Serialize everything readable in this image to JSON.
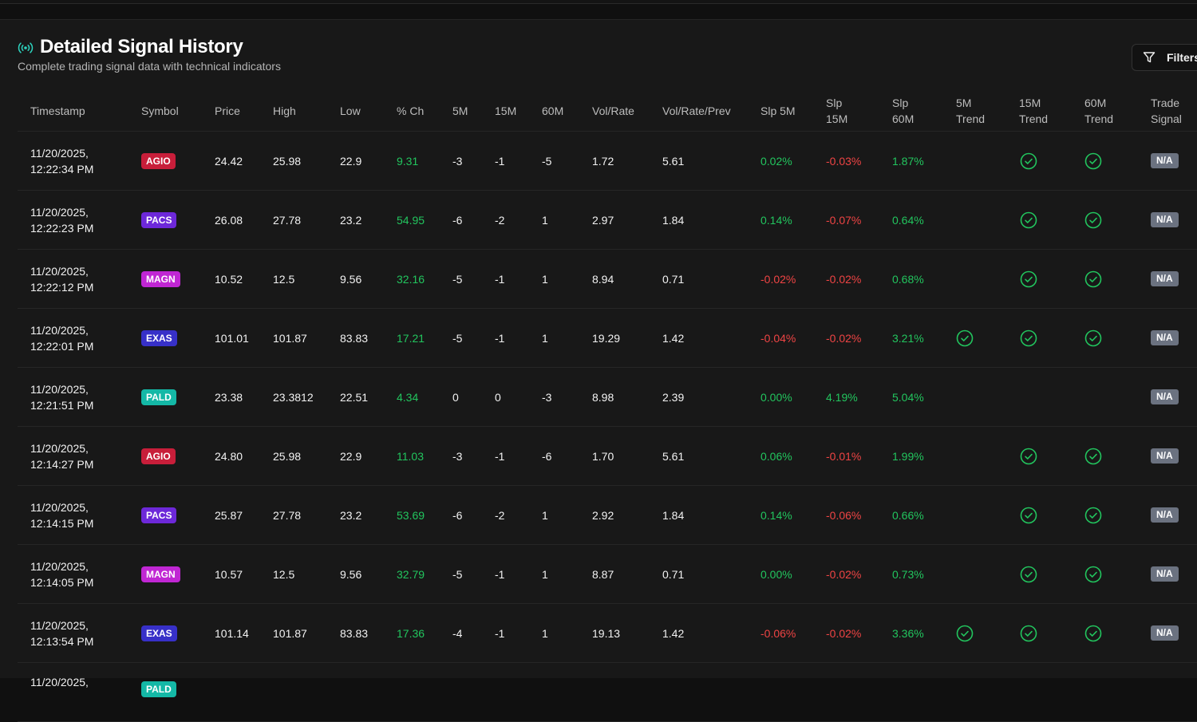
{
  "title": "Detailed Signal History",
  "subtitle": "Complete trading signal data with technical indicators",
  "filters_label": "Filters",
  "colors": {
    "AGIO": "#c81e3a",
    "PACS": "#6d28d9",
    "MAGN": "#c026d3",
    "EXAS": "#3730c8",
    "PALD": "#14b8a6",
    "positive": "#22c55e",
    "negative": "#ef4444"
  },
  "headers": {
    "timestamp": "Timestamp",
    "symbol": "Symbol",
    "price": "Price",
    "high": "High",
    "low": "Low",
    "pct_ch": "% Ch",
    "m5": "5M",
    "m15": "15M",
    "m60": "60M",
    "vol_rate": "Vol/Rate",
    "vol_rate_prev": "Vol/Rate/Prev",
    "slp5": "Slp 5M",
    "slp15_a": "Slp",
    "slp15_b": "15M",
    "slp60_a": "Slp",
    "slp60_b": "60M",
    "t5_a": "5M",
    "t5_b": "Trend",
    "t15_a": "15M",
    "t15_b": "Trend",
    "t60_a": "60M",
    "t60_b": "Trend",
    "sig_a": "Trade",
    "sig_b": "Signal"
  },
  "rows": [
    {
      "date": "11/20/2025,",
      "time": "12:22:34 PM",
      "symbol": "AGIO",
      "price": "24.42",
      "high": "25.98",
      "low": "22.9",
      "pct": "9.31",
      "m5": "-3",
      "m15": "-1",
      "m60": "-5",
      "vol": "1.72",
      "volprev": "5.61",
      "slp5": "0.02%",
      "slp5_pos": true,
      "slp15": "-0.03%",
      "slp15_pos": false,
      "slp60": "1.87%",
      "slp60_pos": true,
      "t5": false,
      "t15": true,
      "t60": true,
      "signal": "N/A"
    },
    {
      "date": "11/20/2025,",
      "time": "12:22:23 PM",
      "symbol": "PACS",
      "price": "26.08",
      "high": "27.78",
      "low": "23.2",
      "pct": "54.95",
      "m5": "-6",
      "m15": "-2",
      "m60": "1",
      "vol": "2.97",
      "volprev": "1.84",
      "slp5": "0.14%",
      "slp5_pos": true,
      "slp15": "-0.07%",
      "slp15_pos": false,
      "slp60": "0.64%",
      "slp60_pos": true,
      "t5": false,
      "t15": true,
      "t60": true,
      "signal": "N/A"
    },
    {
      "date": "11/20/2025,",
      "time": "12:22:12 PM",
      "symbol": "MAGN",
      "price": "10.52",
      "high": "12.5",
      "low": "9.56",
      "pct": "32.16",
      "m5": "-5",
      "m15": "-1",
      "m60": "1",
      "vol": "8.94",
      "volprev": "0.71",
      "slp5": "-0.02%",
      "slp5_pos": false,
      "slp15": "-0.02%",
      "slp15_pos": false,
      "slp60": "0.68%",
      "slp60_pos": true,
      "t5": false,
      "t15": true,
      "t60": true,
      "signal": "N/A"
    },
    {
      "date": "11/20/2025,",
      "time": "12:22:01 PM",
      "symbol": "EXAS",
      "price": "101.01",
      "high": "101.87",
      "low": "83.83",
      "pct": "17.21",
      "m5": "-5",
      "m15": "-1",
      "m60": "1",
      "vol": "19.29",
      "volprev": "1.42",
      "slp5": "-0.04%",
      "slp5_pos": false,
      "slp15": "-0.02%",
      "slp15_pos": false,
      "slp60": "3.21%",
      "slp60_pos": true,
      "t5": true,
      "t15": true,
      "t60": true,
      "signal": "N/A"
    },
    {
      "date": "11/20/2025,",
      "time": "12:21:51 PM",
      "symbol": "PALD",
      "price": "23.38",
      "high": "23.3812",
      "low": "22.51",
      "pct": "4.34",
      "m5": "0",
      "m15": "0",
      "m60": "-3",
      "vol": "8.98",
      "volprev": "2.39",
      "slp5": "0.00%",
      "slp5_pos": true,
      "slp15": "4.19%",
      "slp15_pos": true,
      "slp60": "5.04%",
      "slp60_pos": true,
      "t5": false,
      "t15": false,
      "t60": false,
      "signal": "N/A"
    },
    {
      "date": "11/20/2025,",
      "time": "12:14:27 PM",
      "symbol": "AGIO",
      "price": "24.80",
      "high": "25.98",
      "low": "22.9",
      "pct": "11.03",
      "m5": "-3",
      "m15": "-1",
      "m60": "-6",
      "vol": "1.70",
      "volprev": "5.61",
      "slp5": "0.06%",
      "slp5_pos": true,
      "slp15": "-0.01%",
      "slp15_pos": false,
      "slp60": "1.99%",
      "slp60_pos": true,
      "t5": false,
      "t15": true,
      "t60": true,
      "signal": "N/A"
    },
    {
      "date": "11/20/2025,",
      "time": "12:14:15 PM",
      "symbol": "PACS",
      "price": "25.87",
      "high": "27.78",
      "low": "23.2",
      "pct": "53.69",
      "m5": "-6",
      "m15": "-2",
      "m60": "1",
      "vol": "2.92",
      "volprev": "1.84",
      "slp5": "0.14%",
      "slp5_pos": true,
      "slp15": "-0.06%",
      "slp15_pos": false,
      "slp60": "0.66%",
      "slp60_pos": true,
      "t5": false,
      "t15": true,
      "t60": true,
      "signal": "N/A"
    },
    {
      "date": "11/20/2025,",
      "time": "12:14:05 PM",
      "symbol": "MAGN",
      "price": "10.57",
      "high": "12.5",
      "low": "9.56",
      "pct": "32.79",
      "m5": "-5",
      "m15": "-1",
      "m60": "1",
      "vol": "8.87",
      "volprev": "0.71",
      "slp5": "0.00%",
      "slp5_pos": true,
      "slp15": "-0.02%",
      "slp15_pos": false,
      "slp60": "0.73%",
      "slp60_pos": true,
      "t5": false,
      "t15": true,
      "t60": true,
      "signal": "N/A"
    },
    {
      "date": "11/20/2025,",
      "time": "12:13:54 PM",
      "symbol": "EXAS",
      "price": "101.14",
      "high": "101.87",
      "low": "83.83",
      "pct": "17.36",
      "m5": "-4",
      "m15": "-1",
      "m60": "1",
      "vol": "19.13",
      "volprev": "1.42",
      "slp5": "-0.06%",
      "slp5_pos": false,
      "slp15": "-0.02%",
      "slp15_pos": false,
      "slp60": "3.36%",
      "slp60_pos": true,
      "t5": true,
      "t15": true,
      "t60": true,
      "signal": "N/A"
    }
  ],
  "partial_row": {
    "date": "11/20/2025,",
    "symbol": "PALD"
  }
}
